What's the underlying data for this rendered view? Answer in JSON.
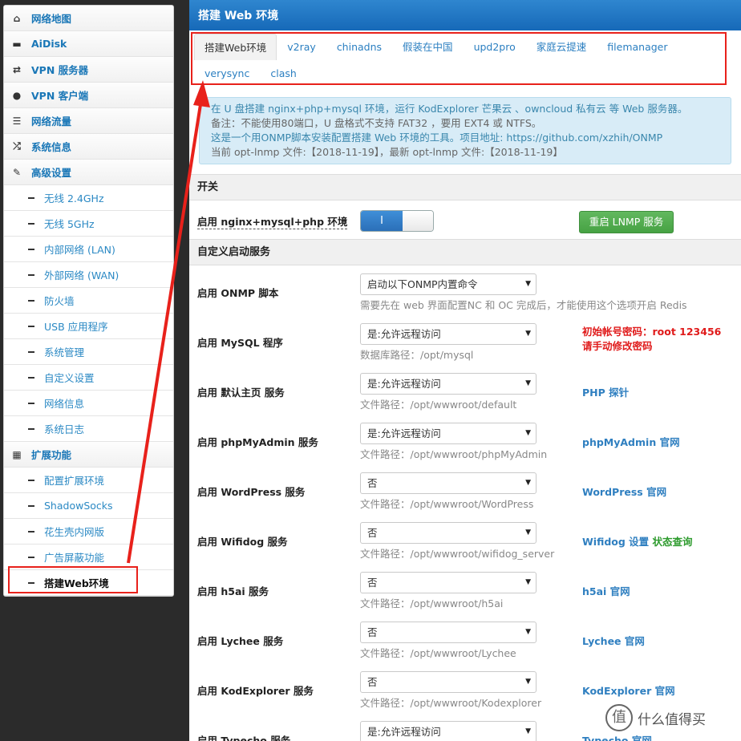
{
  "sidebar": {
    "top_items": [
      {
        "label": "网络地图",
        "icon": "home-icon"
      },
      {
        "label": "AiDisk",
        "icon": "disk-icon"
      },
      {
        "label": "VPN 服务器",
        "icon": "retweet-icon"
      },
      {
        "label": "VPN 客户端",
        "icon": "globe-icon"
      },
      {
        "label": "网络流量",
        "icon": "list-icon"
      },
      {
        "label": "系统信息",
        "icon": "random-icon"
      },
      {
        "label": "高级设置",
        "icon": "wrench-icon"
      }
    ],
    "advanced_items": [
      "无线 2.4GHz",
      "无线 5GHz",
      "内部网络 (LAN)",
      "外部网络 (WAN)",
      "防火墙",
      "USB 应用程序",
      "系统管理",
      "自定义设置",
      "网络信息",
      "系统日志"
    ],
    "extension": {
      "label": "扩展功能",
      "icon": "grid-icon"
    },
    "extension_items": [
      "配置扩展环境",
      "ShadowSocks",
      "花生壳内网版",
      "广告屏蔽功能",
      "搭建Web环境"
    ]
  },
  "panel": {
    "title": "搭建 Web 环境",
    "tabs_row1": [
      "搭建Web环境",
      "v2ray",
      "chinadns",
      "假装在中国",
      "upd2pro",
      "家庭云提速",
      "filemanager"
    ],
    "tabs_row2": [
      "verysync",
      "clash"
    ],
    "info": {
      "line1": "在 U 盘搭建 nginx+php+mysql 环境，运行 KodExplorer 芒果云 、owncloud 私有云 等 Web 服务器。",
      "line2": "备注：不能使用80端口，U 盘格式不支持 FAT32 ，要用 EXT4 或 NTFS。",
      "line3": "这是一个用ONMP脚本安装配置搭建 Web 环境的工具。项目地址: https://github.com/xzhih/ONMP",
      "line4": "当前 opt-lnmp 文件:【2018-11-19】，最新 opt-lnmp 文件:【2018-11-19】"
    },
    "section_switch": "开关",
    "switch_label": "启用 nginx+mysql+php 环境",
    "switch_on_text": "I",
    "switch_on": true,
    "restart_button": "重启 LNMP 服务",
    "section_custom": "自定义启动服务",
    "rows": [
      {
        "label": "启用 ONMP 脚本",
        "select": "启动以下ONMP内置命令",
        "hint": "需要先在 web 界面配置NC 和 OC 完成后，才能使用这个选项开启 Redis"
      },
      {
        "label": "启用 MySQL 程序",
        "select": "是:允许远程访问",
        "hint": "数据库路径：/opt/mysql",
        "warn1": "初始帐号密码：root 123456",
        "warn2": "请手动修改密码"
      },
      {
        "label": "启用 默认主页 服务",
        "select": "是:允许远程访问",
        "hint": "文件路径：/opt/wwwroot/default",
        "link": "PHP 探针"
      },
      {
        "label": "启用 phpMyAdmin 服务",
        "select": "是:允许远程访问",
        "hint": "文件路径：/opt/wwwroot/phpMyAdmin",
        "link": "phpMyAdmin 官网"
      },
      {
        "label": "启用 WordPress 服务",
        "select": "否",
        "hint": "文件路径：/opt/wwwroot/WordPress",
        "link": "WordPress 官网"
      },
      {
        "label": "启用 Wifidog 服务",
        "select": "否",
        "hint": "文件路径：/opt/wwwroot/wifidog_server",
        "link": "Wifidog 设置",
        "link2": "状态查询"
      },
      {
        "label": "启用 h5ai 服务",
        "select": "否",
        "hint": "文件路径：/opt/wwwroot/h5ai",
        "link": "h5ai 官网"
      },
      {
        "label": "启用 Lychee 服务",
        "select": "否",
        "hint": "文件路径：/opt/wwwroot/Lychee",
        "link": "Lychee 官网"
      },
      {
        "label": "启用 KodExplorer 服务",
        "select": "否",
        "hint": "文件路径：/opt/wwwroot/Kodexplorer",
        "link": "KodExplorer 官网"
      },
      {
        "label": "启用 Typecho 服务",
        "select": "是:允许远程访问",
        "hint": "",
        "link": "Typecho 官网"
      }
    ]
  },
  "watermark": {
    "symbol": "值",
    "text": "什么值得买"
  },
  "colors": {
    "highlight": "#e8211b",
    "accent": "#1669b8",
    "link": "#2f7fc0",
    "warn": "#e01b1b"
  }
}
